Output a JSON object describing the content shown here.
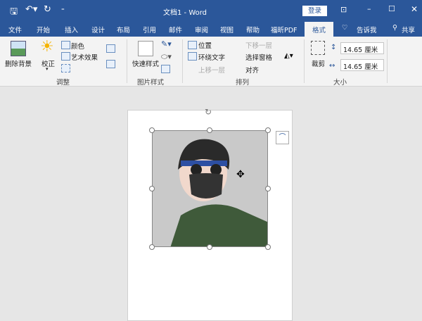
{
  "titlebar": {
    "title": "文档1  -  Word",
    "login": "登录",
    "quick_access": [
      "save-icon",
      "undo-icon",
      "redo-icon",
      "customize-icon"
    ]
  },
  "tabs": [
    "文件",
    "开始",
    "插入",
    "设计",
    "布局",
    "引用",
    "邮件",
    "审阅",
    "视图",
    "帮助",
    "福昕PDF",
    "格式"
  ],
  "active_tab": "格式",
  "tell_me": "告诉我",
  "share": "共享",
  "ribbon": {
    "adjust": {
      "remove_bg": "删除背景",
      "correct": "校正",
      "color": "颜色",
      "artistic": "艺术效果",
      "label": "调整"
    },
    "styles": {
      "quick": "快速样式",
      "label": "图片样式"
    },
    "arrange": {
      "position": "位置",
      "wrap": "环绕文字",
      "forward": "上移一层",
      "backward": "下移一层",
      "selection": "选择窗格",
      "align": "对齐",
      "label": "排列"
    },
    "size": {
      "crop": "裁剪",
      "height": "14.65 厘米",
      "width": "14.65 厘米",
      "label": "大小"
    }
  },
  "colors": {
    "brand": "#2b579a",
    "ribbon": "#f3f3f3",
    "canvas": "#e6e6e6"
  }
}
